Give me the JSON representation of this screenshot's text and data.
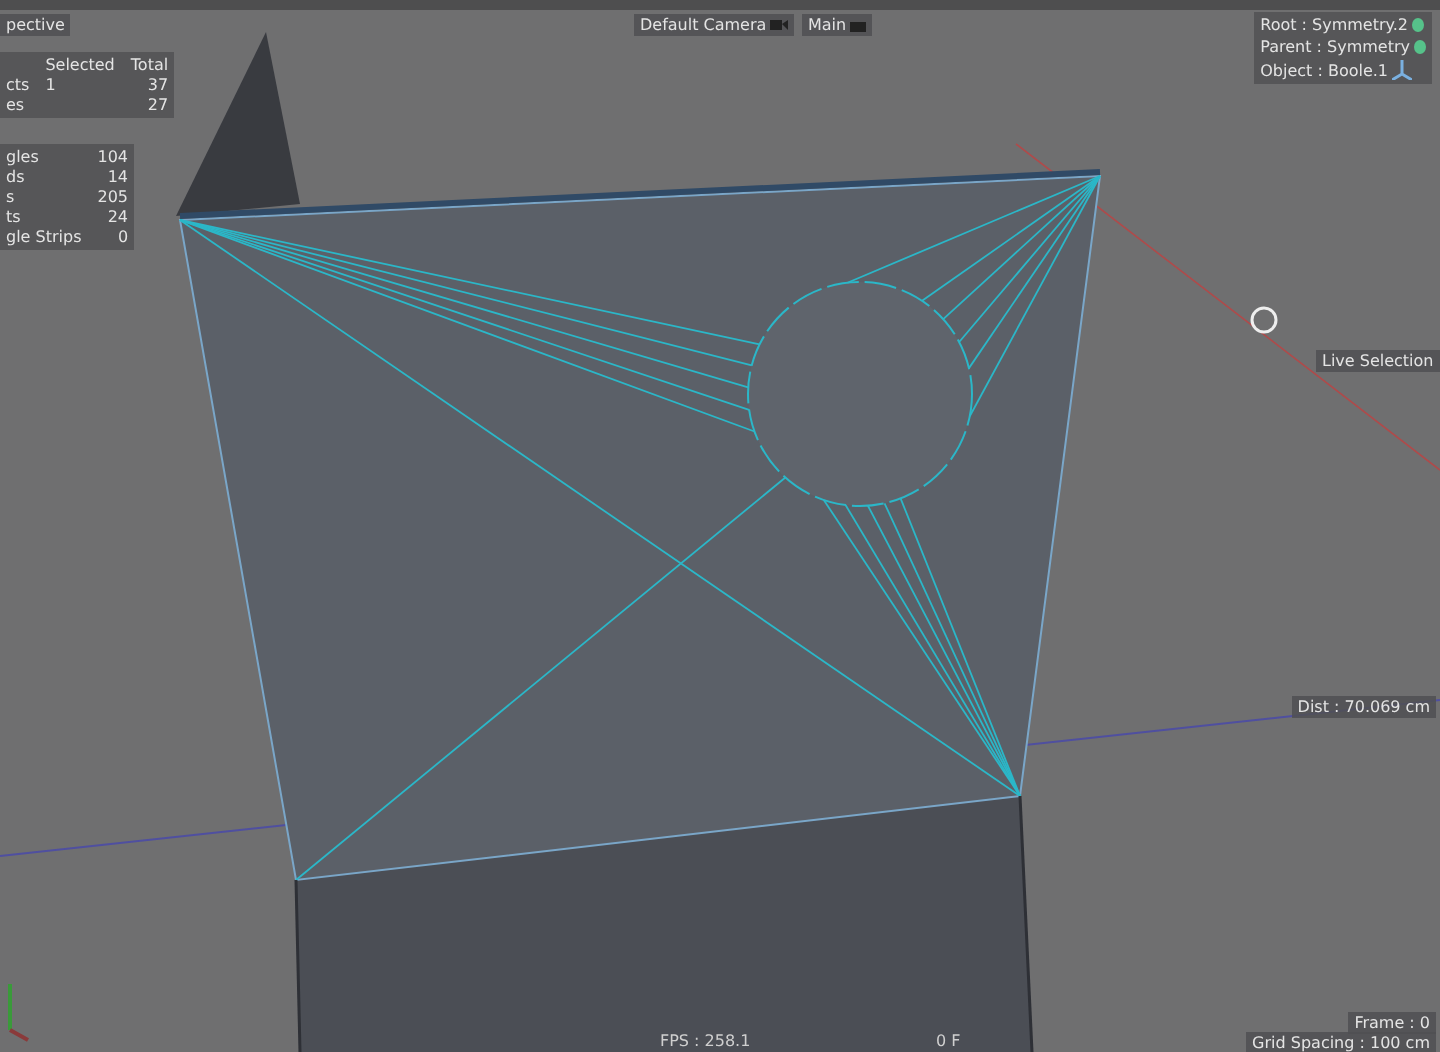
{
  "viewport": {
    "view_label": "pective",
    "camera_label": "Default Camera",
    "display_label": "Main"
  },
  "selection_stats": {
    "columns": [
      "Selected",
      "Total"
    ],
    "rows": [
      {
        "label": "cts",
        "selected": "1",
        "total": "37"
      },
      {
        "label": "es",
        "total": "27"
      }
    ]
  },
  "polygon_stats": [
    {
      "label": "gles",
      "value": "104"
    },
    {
      "label": "ds",
      "value": "14"
    },
    {
      "label": "s",
      "value": "205"
    },
    {
      "label": "ts",
      "value": "24"
    },
    {
      "label": "gle Strips",
      "value": "0"
    }
  ],
  "hierarchy": [
    {
      "kind": "dot",
      "text": "Root : Symmetry.2"
    },
    {
      "kind": "dot",
      "text": "Parent : Symmetry"
    },
    {
      "kind": "axis",
      "text": "Object : Boole.1"
    }
  ],
  "tool_label": "Live Selection",
  "distance": "Dist : 70.069 cm",
  "fps": "FPS : 258.1",
  "frame_count": "0 F",
  "frame": "Frame : 0",
  "grid_spacing": "Grid Spacing : 100 cm"
}
